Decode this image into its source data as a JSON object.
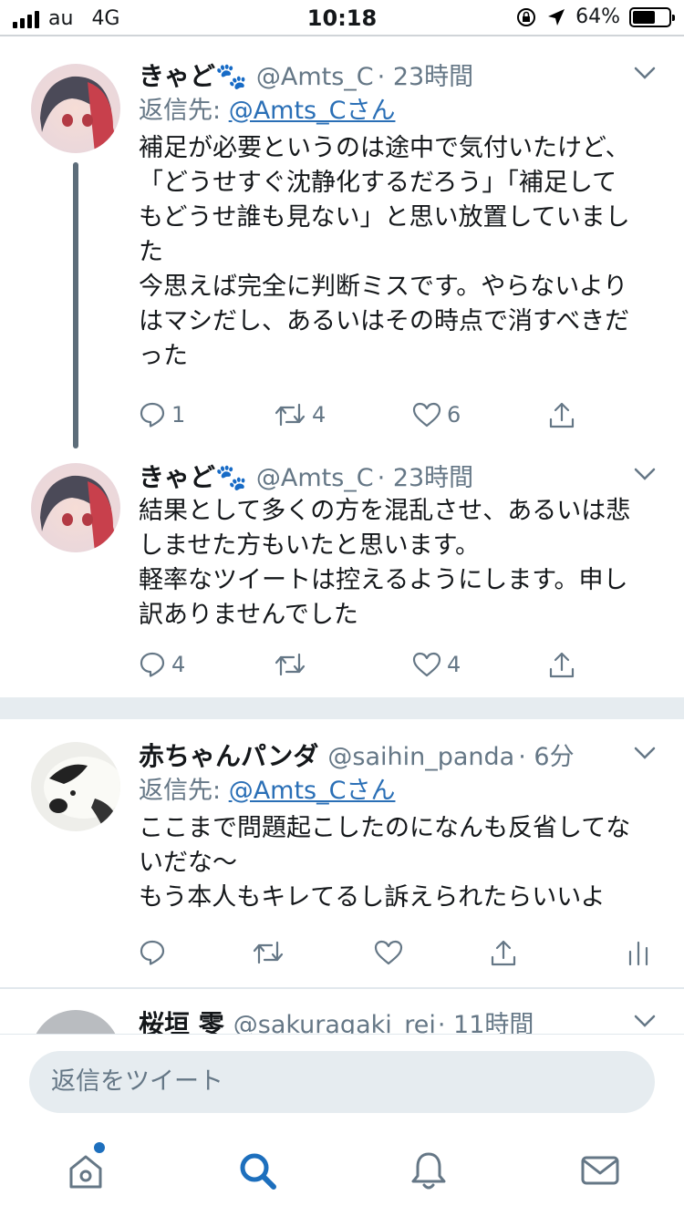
{
  "status_bar": {
    "carrier": "au",
    "network": "4G",
    "time": "10:18",
    "battery_percent": "64%",
    "battery_level": 0.64,
    "icons": [
      "signal-icon",
      "lock-rotation-icon",
      "location-arrow-icon",
      "battery-icon"
    ]
  },
  "tweets": [
    {
      "display_name": "きゃど🐾",
      "handle": "@Amts_C",
      "time": "· 23時間",
      "reply_prefix": "返信先: ",
      "reply_to": "@Amts_Cさん",
      "text": "補足が必要というのは途中で気付いたけど、\n「どうせすぐ沈静化するだろう」「補足して\nもどうせ誰も見ない」と思い放置していまし\nた\n今思えば完全に判断ミスです。やらないより\nはマシだし、あるいはその時点で消すべきだ\nった",
      "reply_count": "1",
      "retweet_count": "4",
      "like_count": "6"
    },
    {
      "display_name": "きゃど🐾",
      "handle": "@Amts_C",
      "time": "· 23時間",
      "text": "結果として多くの方を混乱させ、あるいは悲\nしませた方もいたと思います。\n軽率なツイートは控えるようにします。申し\n訳ありませんでした",
      "reply_count": "4",
      "retweet_count": "",
      "like_count": "4"
    },
    {
      "display_name": "赤ちゃんパンダ",
      "handle": "@saihin_panda",
      "time": "· 6分",
      "reply_prefix": "返信先: ",
      "reply_to": "@Amts_Cさん",
      "text": "ここまで問題起こしたのになんも反省してな\nいだな～\nもう本人もキレてるし訴えられたらいいよ"
    },
    {
      "display_name": "桜垣 零",
      "handle": "@sakuragaki_rei",
      "time": "· 11時間"
    }
  ],
  "composer": {
    "placeholder": "返信をツイート"
  },
  "tabbar": {
    "items": [
      "home-icon",
      "search-icon",
      "notifications-icon",
      "messages-icon"
    ],
    "active": "search-icon"
  },
  "colors": {
    "link": "#2a6fb6",
    "muted": "#657786",
    "active_tab": "#1d6fbd",
    "separator": "#e6ecf0"
  }
}
